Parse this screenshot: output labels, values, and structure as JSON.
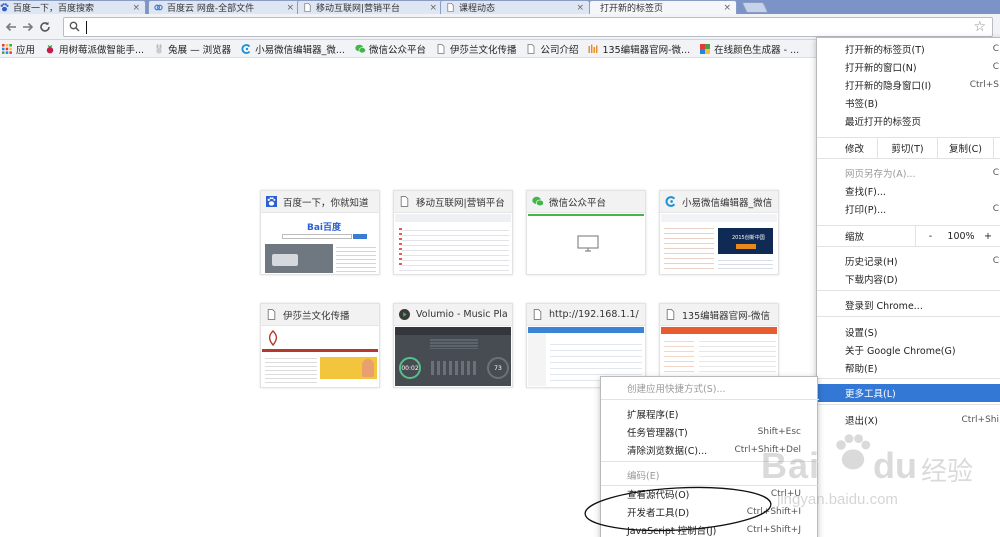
{
  "tabs": [
    {
      "title": "百度一下，百度搜索",
      "close": "×"
    },
    {
      "title": "百度云 网盘-全部文件",
      "close": "×"
    },
    {
      "title": "移动互联网|营销平台",
      "close": "×"
    },
    {
      "title": "课程动态",
      "close": "×"
    },
    {
      "title": "打开新的标签页",
      "close": "×"
    }
  ],
  "toolbar": {
    "back_icon": "back-arrow-icon",
    "forward_icon": "forward-arrow-icon",
    "reload_icon": "reload-icon",
    "omnibox_value": "",
    "star_icon": "star-icon"
  },
  "bookmarks": [
    {
      "label": "应用",
      "icon": "apps-grid-icon"
    },
    {
      "label": "用树莓派做智能手...",
      "icon": "raspberry-icon"
    },
    {
      "label": "兔展 — 浏览器",
      "icon": "rabbit-icon"
    },
    {
      "label": "小易微信编辑器_微...",
      "icon": "xiaoyi-icon"
    },
    {
      "label": "微信公众平台",
      "icon": "wechat-icon"
    },
    {
      "label": "伊莎兰文化传播",
      "icon": "page-icon"
    },
    {
      "label": "公司介绍",
      "icon": "page-icon"
    },
    {
      "label": "135编辑器官网-微...",
      "icon": "135-icon"
    },
    {
      "label": "在线颜色生成器 - ...",
      "icon": "color-icon"
    }
  ],
  "tiles": [
    {
      "title": "百度一下，你就知道",
      "icon": "baidu-paw-icon"
    },
    {
      "title": "移动互联网|营销平台",
      "icon": "page-icon"
    },
    {
      "title": "微信公众平台",
      "icon": "wechat-icon"
    },
    {
      "title": "小易微信编辑器_微信",
      "icon": "xiaoyi-icon"
    },
    {
      "title": "伊莎兰文化传播",
      "icon": "page-icon"
    },
    {
      "title": "Volumio - Music Play",
      "icon": "volumio-icon"
    },
    {
      "title": "http://192.168.1.1/",
      "icon": "page-icon"
    },
    {
      "title": "135编辑器官网-微信",
      "icon": "page-icon"
    }
  ],
  "tile_thumbs": {
    "baidu_logo": "Bai百度",
    "event_banner": "2015创新中国",
    "volumio_time": "00:02",
    "volumio_count": "73"
  },
  "menu": {
    "new_tab": "打开新的标签页(T)",
    "new_tab_sc": "C",
    "new_window": "打开新的窗口(N)",
    "new_window_sc": "C",
    "incognito": "打开新的隐身窗口(I)",
    "incognito_sc": "Ctrl+S",
    "bookmarks": "书签(B)",
    "recent_tabs": "最近打开的标签页",
    "edit": "修改",
    "cut": "剪切(T)",
    "copy": "复制(C)",
    "save_as": "网页另存为(A)...",
    "save_as_sc": "C",
    "find": "查找(F)...",
    "print": "打印(P)...",
    "print_sc": "C",
    "zoom": "缩放",
    "zoom_minus": "-",
    "zoom_value": "100%",
    "zoom_plus": "+",
    "history": "历史记录(H)",
    "history_sc": "C",
    "downloads": "下载内容(D)",
    "sign_in": "登录到 Chrome...",
    "settings": "设置(S)",
    "about": "关于 Google Chrome(G)",
    "help": "帮助(E)",
    "more_tools": "更多工具(L)",
    "exit": "退出(X)",
    "exit_sc": "Ctrl+Shi"
  },
  "submenu": {
    "create_shortcut": "创建应用快捷方式(S)...",
    "extensions": "扩展程序(E)",
    "task_manager": "任务管理器(T)",
    "task_manager_sc": "Shift+Esc",
    "clear_data": "清除浏览数据(C)...",
    "clear_data_sc": "Ctrl+Shift+Del",
    "encoding": "编码(E)",
    "view_source": "查看源代码(O)",
    "view_source_sc": "Ctrl+U",
    "dev_tools": "开发者工具(D)",
    "dev_tools_sc": "Ctrl+Shift+I",
    "js_console": "JavaScript 控制台(J)",
    "js_console_sc": "Ctrl+Shift+J"
  },
  "watermark": {
    "brand": "Bai",
    "brand2": "du",
    "word": "经验",
    "url": "jingyan.baidu.com"
  },
  "colors": {
    "tabstrip": "#7b93c6",
    "menu_highlight": "#3478d6",
    "baidu_blue": "#2e5fcf",
    "wechat_green": "#43b649"
  }
}
